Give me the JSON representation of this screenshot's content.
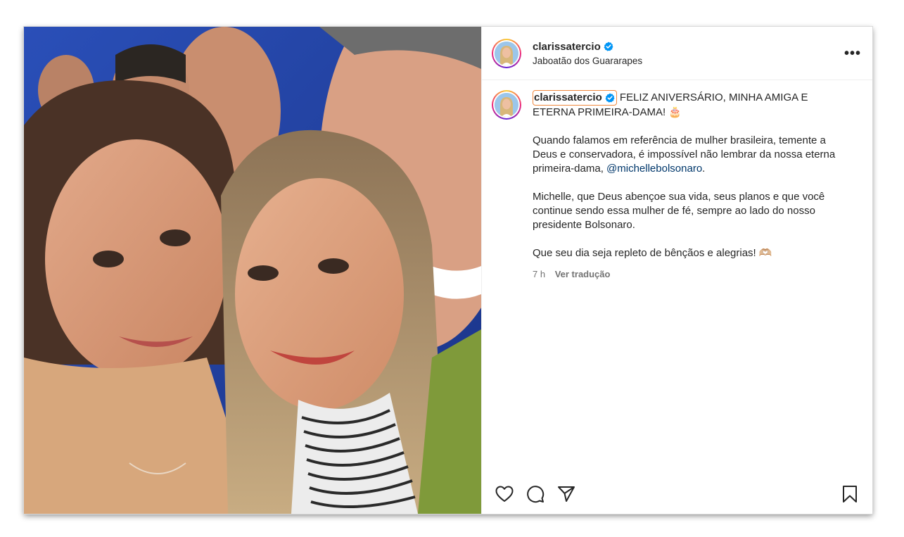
{
  "post": {
    "username": "clarissatercio",
    "location": "Jaboatão dos Guararapes",
    "more_label": "•••",
    "caption": {
      "username": "clarissatercio",
      "line1": "FELIZ ANIVERSÁRIO, MINHA AMIGA E ETERNA PRIMEIRA-DAMA! 🎂",
      "para2_before": "Quando falamos em referência de mulher brasileira, temente a Deus e conservadora, é impossível não lembrar da nossa eterna primeira-dama, ",
      "mention": "@michellebolsonaro",
      "para2_after": ".",
      "para3": "Michelle, que Deus abençoe sua vida, seus planos e que você continue sendo essa mulher de fé, sempre ao lado do nosso presidente Bolsonaro.",
      "para4": "Que seu dia seja repleto de bênçãos e alegrias! 🫶🏼"
    },
    "time": "7 h",
    "translate_label": "Ver tradução"
  },
  "icons": {
    "verified": "verified-badge-icon",
    "like": "heart-icon",
    "comment": "comment-icon",
    "share": "send-icon",
    "save": "bookmark-icon"
  },
  "colors": {
    "verified_blue": "#0095f6",
    "mention_blue": "#00376b",
    "highlight_orange": "#f0883e",
    "muted_text": "#737373"
  }
}
